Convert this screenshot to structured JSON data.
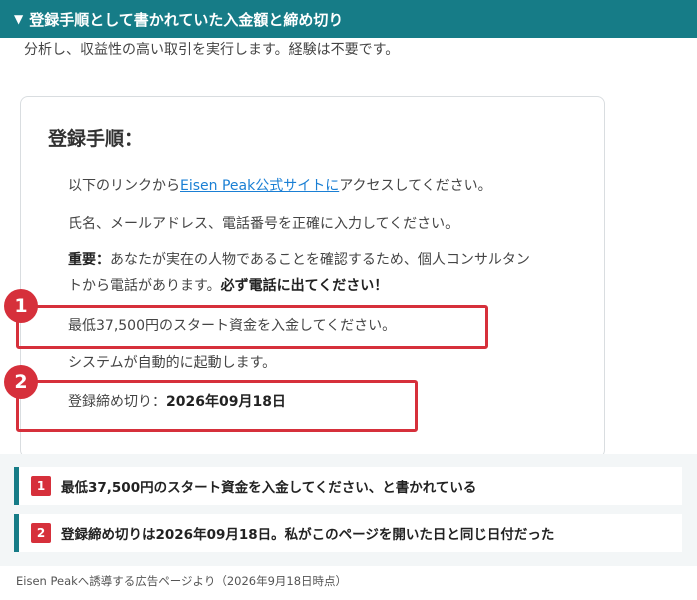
{
  "header": {
    "toggle_icon": "▼",
    "title": "登録手順として書かれていた入金額と締め切り"
  },
  "intro_text": "分析し、収益性の高い取引を実行します。経験は不要です。",
  "card": {
    "title": "登録手順：",
    "step1": {
      "before": "以下のリンクから",
      "link": "Eisen Peak公式サイトに",
      "after": "アクセスしてください。"
    },
    "step2": "氏名、メールアドレス、電話番号を正確に入力してください。",
    "step3": {
      "bold1": "重要：",
      "text1": "あなたが実在の人物であることを確認するため、個人コンサルタン",
      "text2": "トから電話があります。",
      "bold2": "必ず電話に出てください！"
    },
    "step4": "最低37,500円のスタート資金を入金してください。",
    "step5": "システムが自動的に起動します。",
    "step6": {
      "label": "登録締め切り：",
      "date": "2026年09月18日"
    }
  },
  "badges": [
    "1",
    "2"
  ],
  "notes": [
    {
      "num": "1",
      "text": "最低37,500円のスタート資金を入金してください、と書かれている"
    },
    {
      "num": "2",
      "text": "登録締め切りは2026年09月18日。私がこのページを開いた日と同じ日付だった"
    }
  ],
  "footer": "Eisen Peakへ誘導する広告ページより（2026年9月18日時点）",
  "colors": {
    "accent": "#167c87",
    "highlight": "#d6303b",
    "link": "#1a7fd4"
  }
}
